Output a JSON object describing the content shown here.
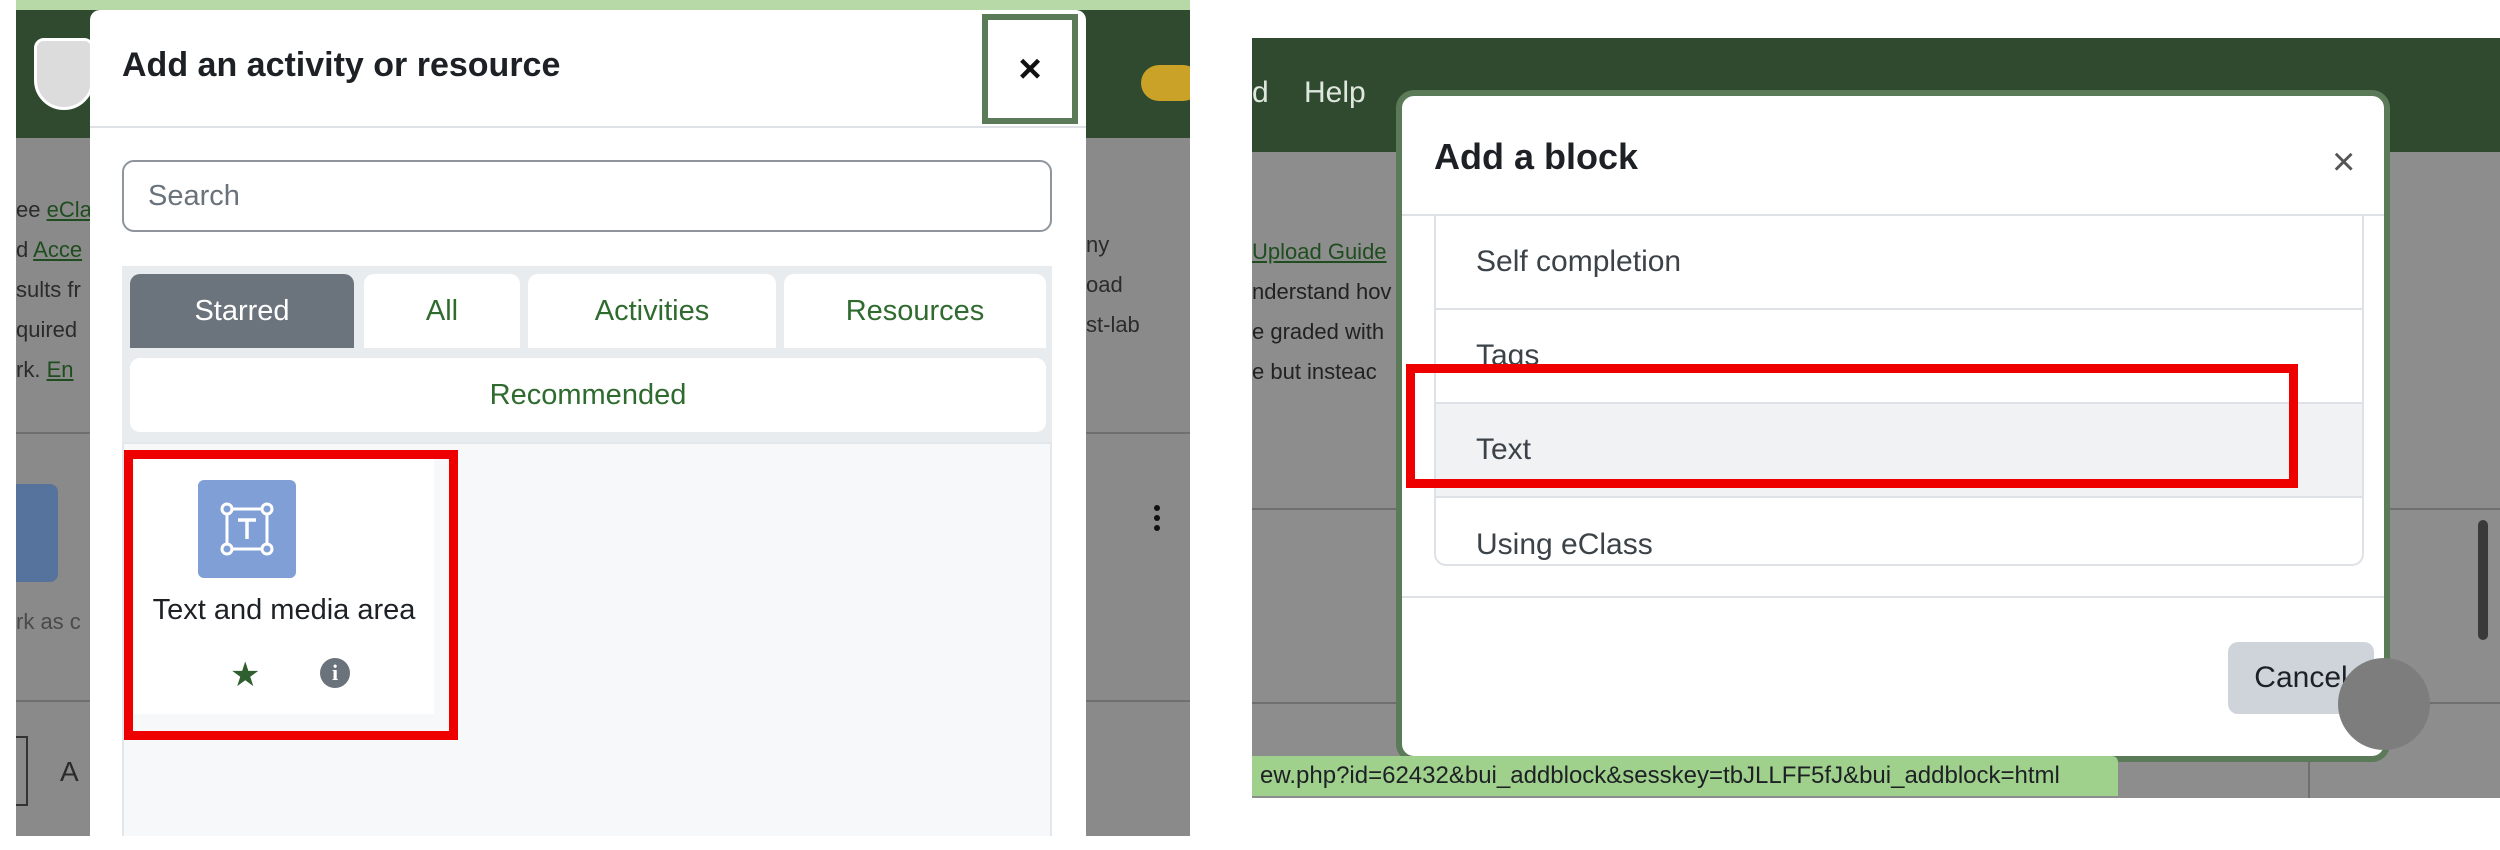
{
  "left": {
    "modal_title": "Add an activity or resource",
    "close_glyph": "×",
    "search_placeholder": "Search",
    "tabs": {
      "starred": "Starred",
      "all": "All",
      "activities": "Activities",
      "resources": "Resources",
      "recommended": "Recommended"
    },
    "card": {
      "label": "Text and media area",
      "icon": "text-media-icon",
      "star_glyph": "★",
      "info_glyph": "i"
    },
    "background_text": {
      "line1_prefix": "ee ",
      "line1_link": "eCla",
      "line2_prefix": "d ",
      "line2_link": "Acce",
      "line3": "sults fr",
      "line4": "quired",
      "line5_prefix": "rk.  ",
      "line5_link": "En",
      "right1": "ny",
      "right2": "oad",
      "right3": "st-lab",
      "rowlabel": "rk as c",
      "bottom_label": "A"
    }
  },
  "right": {
    "nav": {
      "frag": "d",
      "help": "Help"
    },
    "background_text": {
      "link": "Upload Guide",
      "line2": "nderstand hov",
      "line3": "e graded with",
      "line4": "e but insteac"
    },
    "modal_title": "Add a block",
    "close_glyph": "×",
    "items": [
      "Self completion",
      "Tags",
      "Text",
      "Using eClass"
    ],
    "cancel_label": "Cancel",
    "status_url": "ew.php?id=62432&bui_addblock&sesskey=tbJLLFF5fJ&bui_addblock=html"
  },
  "colors": {
    "header_green": "#2f4a2f",
    "accent_green": "#2f6b2f",
    "highlight_red": "#ee0000",
    "active_tab": "#6b737c"
  }
}
